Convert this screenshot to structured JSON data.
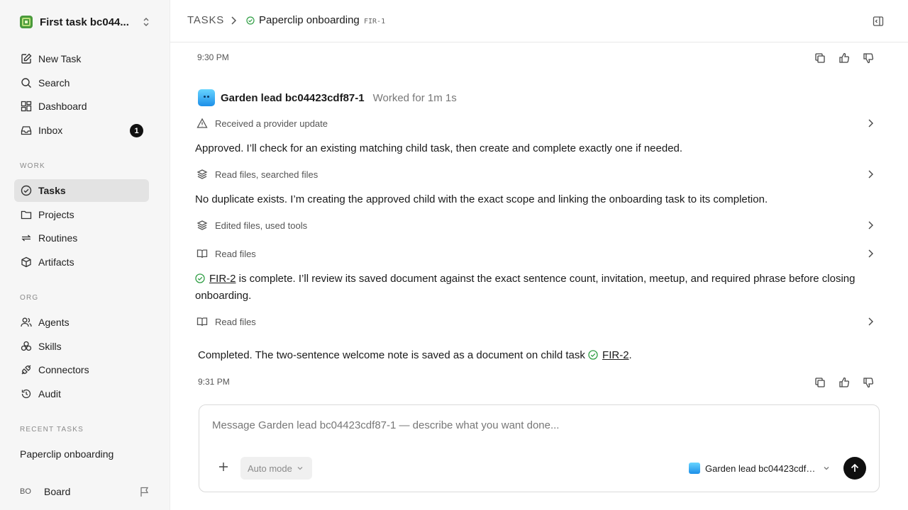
{
  "workspace": {
    "name": "First task bc044...",
    "logo_color": "#4a9a3b"
  },
  "sidebar": {
    "top_items": [
      {
        "label": "New Task",
        "icon": "edit-icon"
      },
      {
        "label": "Search",
        "icon": "search-icon"
      },
      {
        "label": "Dashboard",
        "icon": "dashboard-icon"
      },
      {
        "label": "Inbox",
        "icon": "inbox-icon",
        "badge": "1"
      }
    ],
    "work_label": "WORK",
    "work_items": [
      {
        "label": "Tasks",
        "icon": "check-circle-icon",
        "active": true
      },
      {
        "label": "Projects",
        "icon": "folder-icon"
      },
      {
        "label": "Routines",
        "icon": "repeat-icon"
      },
      {
        "label": "Artifacts",
        "icon": "package-icon"
      }
    ],
    "org_label": "ORG",
    "org_items": [
      {
        "label": "Agents",
        "icon": "users-icon"
      },
      {
        "label": "Skills",
        "icon": "skills-icon"
      },
      {
        "label": "Connectors",
        "icon": "plug-icon"
      },
      {
        "label": "Audit",
        "icon": "history-icon"
      }
    ],
    "recent_label": "RECENT TASKS",
    "recent_items": [
      "Paperclip onboarding"
    ],
    "user": {
      "initials": "BO",
      "label": "Board"
    }
  },
  "header": {
    "root": "TASKS",
    "title": "Paperclip onboarding",
    "task_id": "FIR-1",
    "status_color": "#2f9e44"
  },
  "thread": {
    "top_time": "9:30 PM",
    "agent": {
      "name": "Garden lead bc04423cdf87-1",
      "meta": "Worked for 1m 1s"
    },
    "steps": [
      {
        "icon": "warning-icon",
        "label": "Received a provider update"
      },
      {
        "icon": "layers-icon",
        "label": "Read files, searched files"
      },
      {
        "icon": "layers-icon",
        "label": "Edited files, used tools"
      },
      {
        "icon": "book-icon",
        "label": "Read files"
      },
      {
        "icon": "book-icon",
        "label": "Read files"
      }
    ],
    "messages": {
      "m1": "Approved. I’ll check for an existing matching child task, then create and complete exactly one if needed.",
      "m2": "No duplicate exists. I’m creating the approved child with the exact scope and linking the onboarding task to its completion.",
      "m3_link": "FIR-2",
      "m3_rest": " is complete. I’ll review its saved document against the exact sentence count, invitation, meetup, and required phrase before closing onboarding.",
      "final_prefix": "Completed. The two-sentence welcome note is saved as a document on child task ",
      "final_link": "FIR-2",
      "final_suffix": "."
    },
    "bottom_time": "9:31 PM"
  },
  "composer": {
    "placeholder": "Message Garden lead bc04423cdf87-1 — describe what you want done...",
    "mode": "Auto mode",
    "agent": "Garden lead bc04423cdf87-1"
  }
}
